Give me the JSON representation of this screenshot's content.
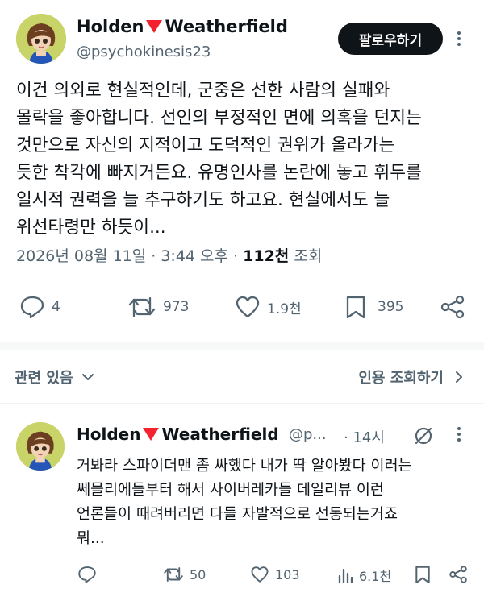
{
  "tweet": {
    "author_name_part1": "Holden",
    "author_name_part2": "Weatherfield",
    "handle": "@psychokinesis23",
    "follow_label": "팔로우하기",
    "body": "이건 의외로 현실적인데, 군중은 선한 사람의 실패와\n몰락을 좋아합니다. 선인의 부정적인 면에 의혹을 던지는\n것만으로 자신의 지적이고 도덕적인 권위가 올라가는\n듯한 착각에 빠지거든요. 유명인사를 논란에 놓고 휘두를\n일시적 권력을 늘 추구하기도 하고요. 현실에서도 늘\n위선타령만 하듯이...",
    "date_text": "2026년 08월 11일 · 3:44 오후 · ",
    "views_count": "112천",
    "views_label": " 조회",
    "stats": {
      "replies": "4",
      "retweets": "973",
      "likes": "1.9천",
      "bookmarks": "395"
    }
  },
  "related": {
    "label": "관련 있음",
    "quotes_label": "인용 조회하기"
  },
  "reply": {
    "author_name_part1": "Holden",
    "author_name_part2": "Weatherfield",
    "handle": "@p...",
    "time": "· 14시",
    "body": "거봐라 스파이더맨 좀 싸했다 내가 딱 알아봤다 이러는\n쎄믈리에들부터 해서 사이버레카들 데일리뷰 이런\n언론들이 때려버리면 다들 자발적으로 선동되는거죠\n뭐...",
    "stats": {
      "retweets": "50",
      "likes": "103",
      "views": "6.1천"
    }
  },
  "colors": {
    "accent_red": "#f4212e",
    "text_primary": "#0f1419",
    "text_secondary": "#536471",
    "divider": "#eff3f4"
  }
}
